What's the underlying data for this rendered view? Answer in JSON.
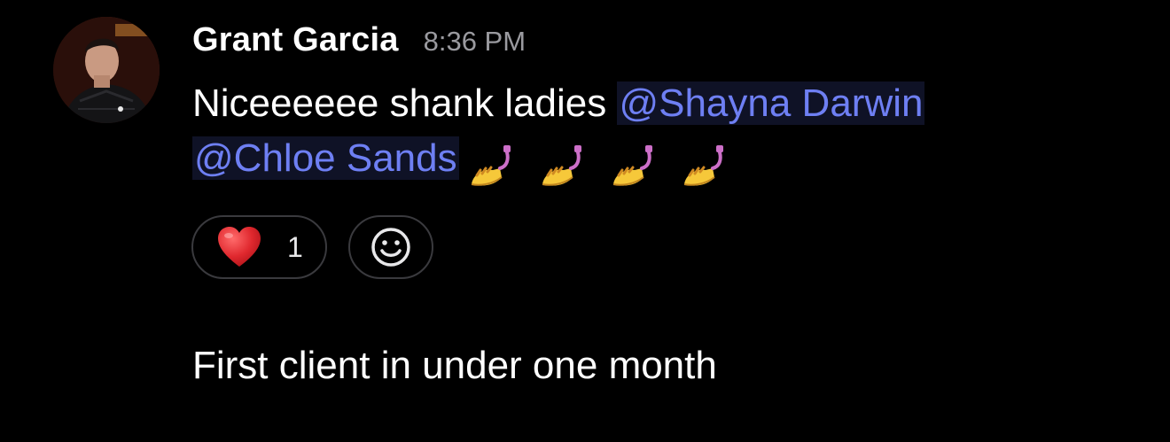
{
  "message": {
    "author": "Grant Garcia",
    "timestamp": "8:36 PM",
    "text_prefix": "Niceeeeee shank ladies ",
    "mentions": [
      "@Shayna Darwin",
      "@Chloe Sands"
    ],
    "emojis": [
      "nail-polish-icon",
      "nail-polish-icon",
      "nail-polish-icon",
      "nail-polish-icon"
    ],
    "reactions": [
      {
        "emoji": "heart-icon",
        "count": "1"
      }
    ],
    "add_reaction_icon": "smiley-add-icon"
  },
  "next_message": {
    "text": "First client in under one month"
  },
  "colors": {
    "background": "#000000",
    "mention_text": "#6e7ff3",
    "mention_bg": "#0f1226",
    "timestamp": "#9a9a9f",
    "chip_border": "#3a3a3e",
    "heart": "#e0282e"
  }
}
